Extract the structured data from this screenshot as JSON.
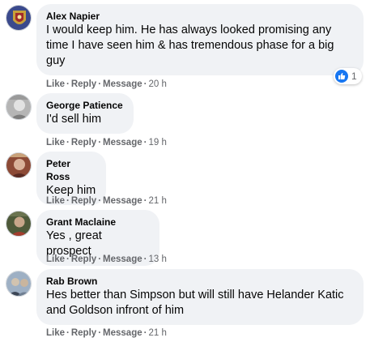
{
  "comments": [
    {
      "author": "Alex Napier",
      "text": "I would keep him. He has always looked promising any time I have seen him & has tremendous phase for a big guy",
      "actions": {
        "like": "Like",
        "reply": "Reply",
        "message": "Message"
      },
      "time": "20 h",
      "reaction": {
        "icon": "thumbs-up-icon",
        "count": "1"
      },
      "avatar_colors": [
        "#3b4a8c",
        "#c8a13a"
      ]
    },
    {
      "author": "George Patience",
      "text": "I'd sell him",
      "actions": {
        "like": "Like",
        "reply": "Reply",
        "message": "Message"
      },
      "time": "19 h",
      "avatar_colors": [
        "#8a8a8a",
        "#c9c9c9"
      ]
    },
    {
      "author": "Peter Ross",
      "text": "Keep him",
      "actions": {
        "like": "Like",
        "reply": "Reply",
        "message": "Message"
      },
      "time": "21 h",
      "avatar_colors": [
        "#7a3b2e",
        "#d9b29a"
      ]
    },
    {
      "author": "Grant Maclaine",
      "text": "Yes , great prospect",
      "actions": {
        "like": "Like",
        "reply": "Reply",
        "message": "Message"
      },
      "time": "13 h",
      "avatar_colors": [
        "#4e5a3a",
        "#a33d2e"
      ]
    },
    {
      "author": "Rab Brown",
      "text": "Hes better than Simpson but will still have Helander Katic and Goldson infront of him",
      "actions": {
        "like": "Like",
        "reply": "Reply",
        "message": "Message"
      },
      "time": "21 h",
      "avatar_colors": [
        "#6f7f92",
        "#d1c3b0"
      ]
    }
  ],
  "separator": "·",
  "colors": {
    "bubble": "#f0f2f5",
    "meta": "#65676b",
    "like_blue": "#1877f2"
  }
}
